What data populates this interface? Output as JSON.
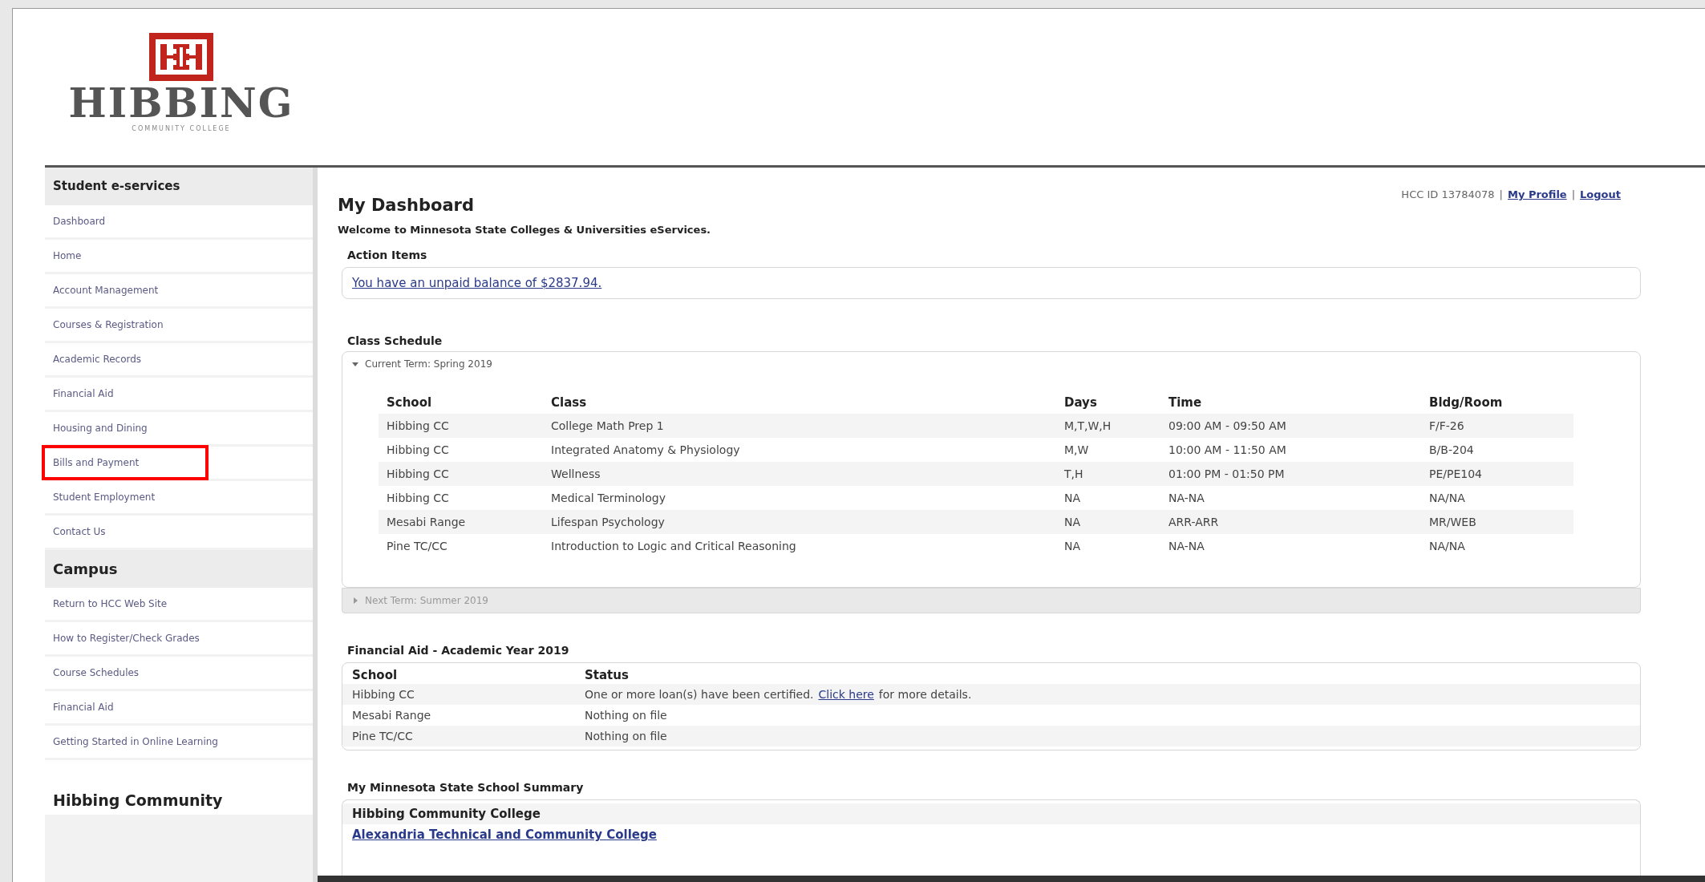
{
  "logo": {
    "name": "HIBBING",
    "subtitle": "COMMUNITY COLLEGE"
  },
  "sidebar": [
    {
      "title": "Student e-services",
      "items": [
        {
          "label": "Dashboard",
          "highlighted": false
        },
        {
          "label": "Home",
          "highlighted": false
        },
        {
          "label": "Account Management",
          "highlighted": false
        },
        {
          "label": "Courses & Registration",
          "highlighted": false
        },
        {
          "label": "Academic Records",
          "highlighted": false
        },
        {
          "label": "Financial Aid",
          "highlighted": false
        },
        {
          "label": "Housing and Dining",
          "highlighted": false
        },
        {
          "label": "Bills and Payment",
          "highlighted": true
        },
        {
          "label": "Student Employment",
          "highlighted": false
        },
        {
          "label": "Contact Us",
          "highlighted": false
        }
      ]
    },
    {
      "title": "Campus",
      "items": [
        {
          "label": "Return to HCC Web Site",
          "highlighted": false
        },
        {
          "label": "How to Register/Check Grades",
          "highlighted": false
        },
        {
          "label": "Course Schedules",
          "highlighted": false
        },
        {
          "label": "Financial Aid",
          "highlighted": false
        },
        {
          "label": "Getting Started in Online Learning",
          "highlighted": false
        }
      ]
    },
    {
      "title": "Hibbing Community"
    }
  ],
  "header_links": [
    {
      "kind": "text",
      "text": "HCC ID 13784078"
    },
    {
      "kind": "separator",
      "text": "|"
    },
    {
      "kind": "link",
      "text": "My Profile"
    },
    {
      "kind": "separator",
      "text": "|"
    },
    {
      "kind": "link",
      "text": "Logout"
    }
  ],
  "title": "My Dashboard",
  "welcome": "Welcome to Minnesota State Colleges & Universities eServices.",
  "action_items": {
    "title": "Action Items",
    "items": [
      "You have an unpaid balance of $2837.94."
    ]
  },
  "class_schedule": {
    "title": "Class Schedule",
    "columns": [
      "School",
      "Class",
      "Days",
      "Time",
      "Bldg/Room"
    ],
    "terms": [
      {
        "label": "Current Term: Spring 2019",
        "expanded": true,
        "rows": [
          [
            "Hibbing CC",
            "College Math Prep 1",
            "M,T,W,H",
            "09:00 AM - 09:50 AM",
            "F/F-26"
          ],
          [
            "Hibbing CC",
            "Integrated Anatomy & Physiology",
            "M,W",
            "10:00 AM - 11:50 AM",
            "B/B-204"
          ],
          [
            "Hibbing CC",
            "Wellness",
            "T,H",
            "01:00 PM - 01:50 PM",
            "PE/PE104"
          ],
          [
            "Hibbing CC",
            "Medical Terminology",
            "NA",
            "NA-NA",
            "NA/NA"
          ],
          [
            "Mesabi Range",
            "Lifespan Psychology",
            "NA",
            "ARR-ARR",
            "MR/WEB"
          ],
          [
            "Pine TC/CC",
            "Introduction to Logic and Critical Reasoning",
            "NA",
            "NA-NA",
            "NA/NA"
          ]
        ]
      },
      {
        "label": "Next Term: Summer 2019",
        "expanded": false
      }
    ]
  },
  "financial_aid": {
    "title": "Financial Aid - Academic Year 2019",
    "columns": [
      "School",
      "Status"
    ],
    "rows": [
      {
        "school": "Hibbing CC",
        "status": "One or more loan(s) have been certified.",
        "link": "Click here",
        "after": "for more details."
      },
      {
        "school": "Mesabi Range",
        "status": "Nothing on file"
      },
      {
        "school": "Pine TC/CC",
        "status": "Nothing on file"
      }
    ]
  },
  "school_summary": {
    "title": "My Minnesota State School Summary",
    "rows": [
      {
        "kind": "heading",
        "text": "Hibbing Community College"
      },
      {
        "kind": "link",
        "text": "Alexandria Technical and Community College"
      }
    ]
  }
}
